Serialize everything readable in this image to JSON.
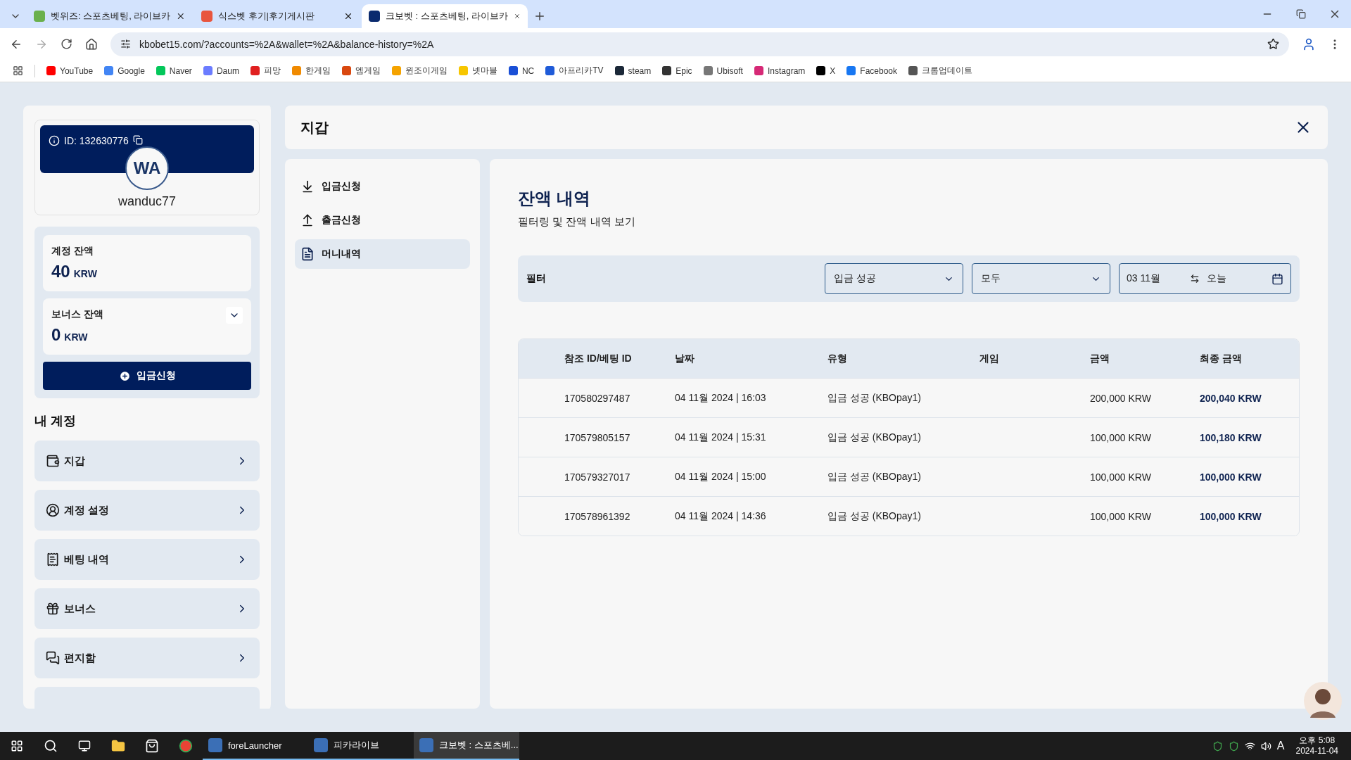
{
  "browser": {
    "tabs": [
      {
        "title": "벳위즈: 스포츠베팅, 라이브카",
        "selected": false,
        "color": "#6ab04c"
      },
      {
        "title": "식스벳 후기|후기게시판",
        "selected": false,
        "color": "#e8553e"
      },
      {
        "title": "크보벳 : 스포츠베팅, 라이브카",
        "selected": true,
        "color": "#0a2a6e"
      }
    ],
    "address": "kbobet15.com/?accounts=%2A&wallet=%2A&balance-history=%2A",
    "bookmarks": [
      {
        "label": "YouTube",
        "color": "#ff0000"
      },
      {
        "label": "Google",
        "color": "#4285f4"
      },
      {
        "label": "Naver",
        "color": "#03c75a"
      },
      {
        "label": "Daum",
        "color": "#6b7cff"
      },
      {
        "label": "피망",
        "color": "#e02020"
      },
      {
        "label": "한게임",
        "color": "#f08a00"
      },
      {
        "label": "엠게임",
        "color": "#d9480f"
      },
      {
        "label": "윈조이게임",
        "color": "#f5a300"
      },
      {
        "label": "넷마블",
        "color": "#f7c600"
      },
      {
        "label": "NC",
        "color": "#1a4fd6"
      },
      {
        "label": "아프리카TV",
        "color": "#1f5bd8"
      },
      {
        "label": "steam",
        "color": "#1b2838"
      },
      {
        "label": "Epic",
        "color": "#333333"
      },
      {
        "label": "Ubisoft",
        "color": "#777777"
      },
      {
        "label": "Instagram",
        "color": "#d62976"
      },
      {
        "label": "X",
        "color": "#000000"
      },
      {
        "label": "Facebook",
        "color": "#1877f2"
      },
      {
        "label": "크롬업데이트",
        "color": "#555555"
      }
    ]
  },
  "sidebar": {
    "profile": {
      "id": "ID: 132630776",
      "initials": "WA",
      "username": "wanduc77"
    },
    "balances": [
      {
        "kind": "plain",
        "label": "계정 잔액",
        "amount": "40",
        "currency": "KRW"
      },
      {
        "kind": "expandable",
        "label": "보너스 잔액",
        "amount": "0",
        "currency": "KRW"
      }
    ],
    "deposit_button": "입금신청",
    "section_title": "내 계정",
    "menu": [
      {
        "kind": "wallet",
        "label": "지갑"
      },
      {
        "kind": "account",
        "label": "계정 설정"
      },
      {
        "kind": "bets",
        "label": "베팅 내역"
      },
      {
        "kind": "bonus",
        "label": "보너스"
      },
      {
        "kind": "mail",
        "label": "편지함"
      },
      {
        "kind": "cut"
      }
    ]
  },
  "wallet": {
    "title": "지갑",
    "nav": [
      {
        "kind": "deposit",
        "label": "입금신청",
        "selected": false
      },
      {
        "kind": "withdraw",
        "label": "출금신청",
        "selected": false
      },
      {
        "kind": "history",
        "label": "머니내역",
        "selected": true
      }
    ],
    "heading": "잔액 내역",
    "subtitle": "필터링 및 잔액 내역 보기",
    "filter": {
      "label": "필터",
      "selects": [
        "입금 성공",
        "모두"
      ],
      "date_from": "03 11월",
      "date_to": "오늘"
    },
    "table": {
      "columns": [
        "참조 ID/베팅 ID",
        "날짜",
        "유형",
        "게임",
        "금액",
        "최종 금액"
      ],
      "rows": [
        [
          "170580297487",
          "04 11월 2024 | 16:03",
          "입금 성공 (KBOpay1)",
          "",
          "200,000 KRW",
          "200,040 KRW"
        ],
        [
          "170579805157",
          "04 11월 2024 | 15:31",
          "입금 성공 (KBOpay1)",
          "",
          "100,000 KRW",
          "100,180 KRW"
        ],
        [
          "170579327017",
          "04 11월 2024 | 15:00",
          "입금 성공 (KBOpay1)",
          "",
          "100,000 KRW",
          "100,000 KRW"
        ],
        [
          "170578961392",
          "04 11월 2024 | 14:36",
          "입금 성공 (KBOpay1)",
          "",
          "100,000 KRW",
          "100,000 KRW"
        ]
      ]
    }
  },
  "taskbar": {
    "apps": [
      {
        "label": "foreLauncher",
        "active": false
      },
      {
        "label": "피카라이브",
        "active": false
      },
      {
        "label": "크보벳 : 스포츠베...",
        "active": true
      }
    ],
    "time": "오후 5:08",
    "date": "2024-11-04",
    "ime": "A"
  }
}
